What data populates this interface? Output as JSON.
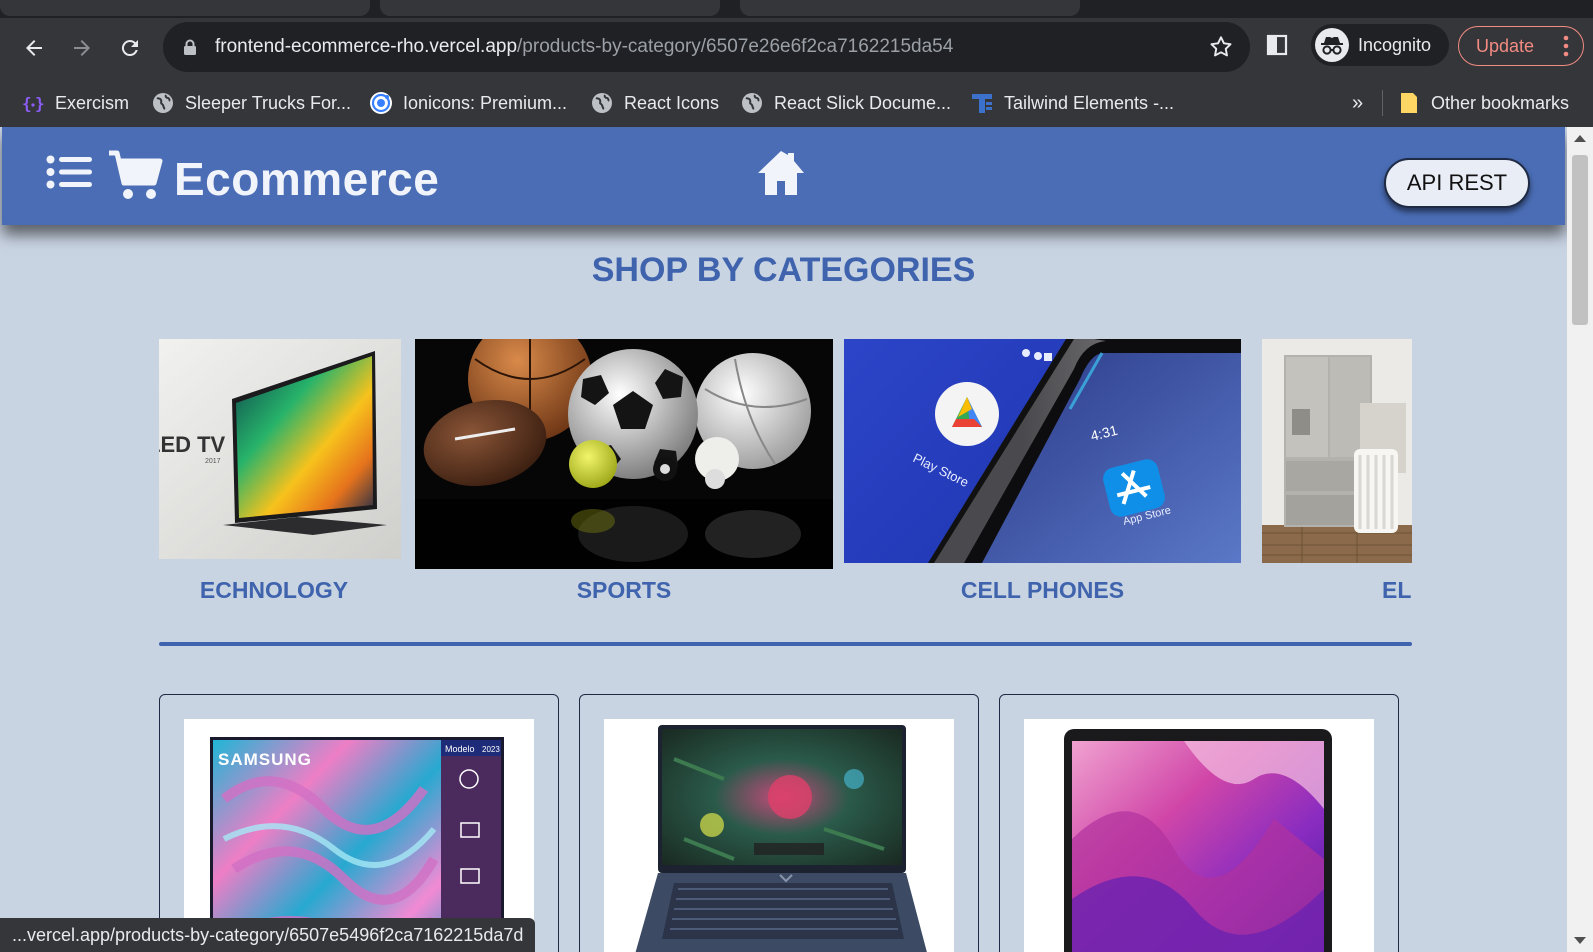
{
  "browser": {
    "url_host": "frontend-ecommerce-rho.vercel.app",
    "url_path": "/products-by-category/6507e26e6f2ca7162215da54",
    "profile_label": "Incognito",
    "update_label": "Update",
    "status_url": "...vercel.app/products-by-category/6507e5496f2ca7162215da7d",
    "bookmarks": [
      {
        "label": "Exercism",
        "icon": "exercism-icon"
      },
      {
        "label": "Sleeper Trucks For...",
        "icon": "globe-icon"
      },
      {
        "label": "Ionicons: Premium...",
        "icon": "ionicons-icon"
      },
      {
        "label": "React Icons",
        "icon": "globe-icon"
      },
      {
        "label": "React Slick Docume...",
        "icon": "globe-icon"
      },
      {
        "label": "Tailwind Elements -...",
        "icon": "tailwind-elements-icon"
      }
    ],
    "overflow_label": "»",
    "other_bookmarks_label": "Other bookmarks"
  },
  "site": {
    "brand": "Ecommerce",
    "api_button": "API REST",
    "section_title": "SHOP BY CATEGORIES",
    "categories": [
      {
        "label": "ECHNOLOGY",
        "image": "oled-tv"
      },
      {
        "label": "SPORTS",
        "image": "sports-balls"
      },
      {
        "label": "CELL PHONES",
        "image": "phones-app-stores"
      },
      {
        "label": "EL",
        "image": "appliances"
      }
    ],
    "products": [
      {
        "image": "samsung-tv"
      },
      {
        "image": "gaming-laptop"
      },
      {
        "image": "macbook"
      }
    ]
  },
  "images": {
    "oled_tv_text": "LED TV",
    "oled_tv_year": "2017",
    "play_store_text": "Play Store",
    "app_store_text": "App Store",
    "phone_time": "4:31",
    "samsung_brand": "SAMSUNG",
    "samsung_badge": "Modelo",
    "samsung_year": "2023"
  },
  "colors": {
    "header": "#4a6db5",
    "page_background": "#c9d4e3",
    "accent": "#3f63ad"
  }
}
